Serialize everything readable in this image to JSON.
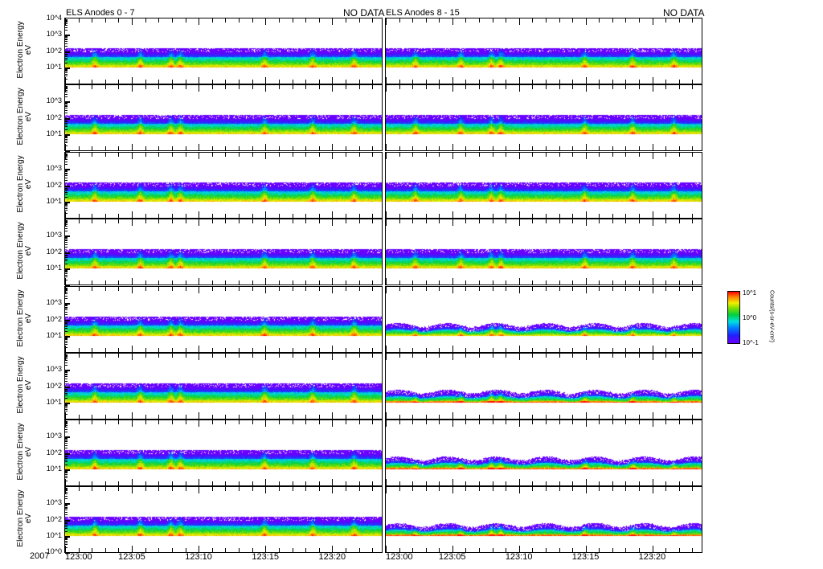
{
  "titles": {
    "left": "ELS Anodes 0 - 7",
    "right": "ELS Anodes 8 - 15",
    "left_status": "NO DATA",
    "right_status": "NO DATA"
  },
  "year_label": "2007",
  "chart_data": {
    "type": "heatmap",
    "panel_rows": 8,
    "panel_columns": 2,
    "ylabel": "Electron Energy",
    "yunits": "eV",
    "yscale": "log",
    "ylim": [
      1,
      10000
    ],
    "ytick_labels_top": [
      "10^4",
      "10^3",
      "10^2",
      "10^1"
    ],
    "ytick_labels": [
      "10^3",
      "10^2",
      "10^1"
    ],
    "ytick_labels_bottom": [
      "10^3",
      "10^2",
      "10^1",
      "10^0"
    ],
    "xlabel": "",
    "xlim": [
      "123:00",
      "123:23.7"
    ],
    "xtick_labels": [
      "123:00",
      "123:05",
      "123:10",
      "123:15",
      "123:20"
    ],
    "data_energy_range_eV": [
      10,
      140
    ],
    "colorbar": {
      "label": "Counts/(s-sr-eV-cm²)",
      "tick_labels": [
        "10^-1",
        "10^0",
        "10^1"
      ]
    }
  }
}
